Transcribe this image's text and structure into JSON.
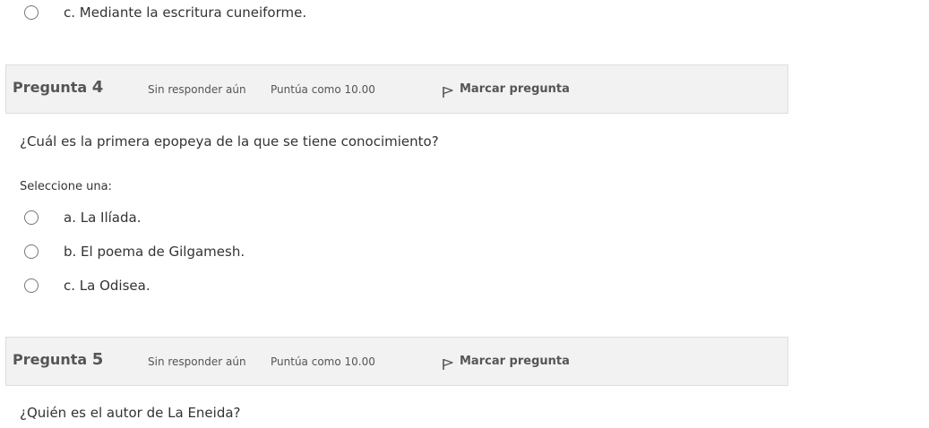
{
  "previous_question": {
    "options": [
      {
        "label": "c. Mediante la escritura cuneiforme."
      }
    ]
  },
  "questions": [
    {
      "title_label": "Pregunta",
      "number": "4",
      "state": "Sin responder aún",
      "grade": "Puntúa como 10.00",
      "flag_label": "Marcar pregunta",
      "text": "¿Cuál es la primera epopeya de la que se tiene conocimiento?",
      "prompt": "Seleccione una:",
      "options": [
        {
          "label": "a. La Ilíada."
        },
        {
          "label": "b. El poema de Gilgamesh."
        },
        {
          "label": "c. La Odisea."
        }
      ]
    },
    {
      "title_label": "Pregunta",
      "number": "5",
      "state": "Sin responder aún",
      "grade": "Puntúa como 10.00",
      "flag_label": "Marcar pregunta",
      "text": "¿Quién es el autor de La Eneida?"
    }
  ],
  "icons": {
    "radio": "radio-button-icon",
    "flag": "flag-icon"
  },
  "colors": {
    "header_bg": "#f2f2f2",
    "header_border": "#dedede",
    "text": "#333333",
    "muted": "#555555"
  }
}
